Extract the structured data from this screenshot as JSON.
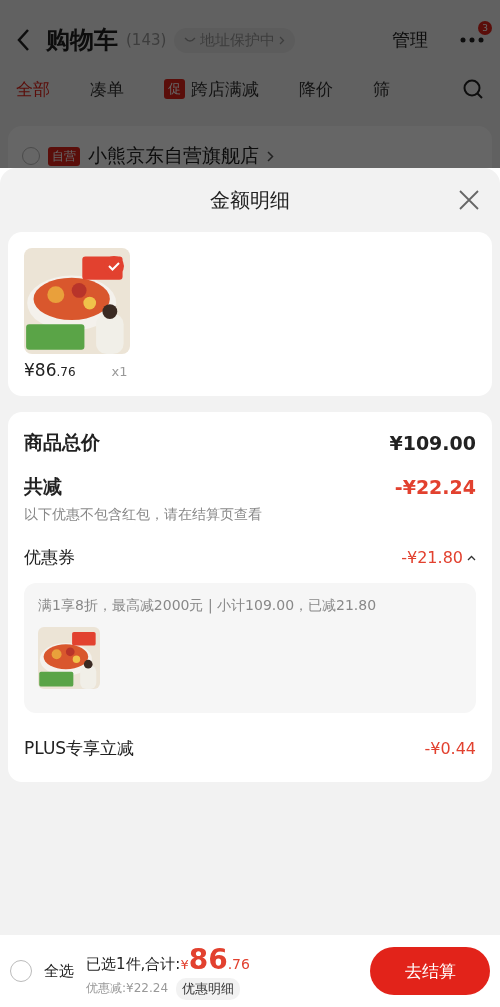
{
  "header": {
    "title": "购物车",
    "count": "(143)",
    "address_chip": "地址保护中",
    "manage": "管理",
    "more_badge": "3"
  },
  "tabs": [
    {
      "label": "全部",
      "selected": true
    },
    {
      "label": "凑单",
      "selected": false
    },
    {
      "label": "跨店满减",
      "tag": "促",
      "selected": false
    },
    {
      "label": "降价",
      "selected": false
    },
    {
      "label": "筛",
      "selected": false
    }
  ],
  "store": {
    "tag": "自营",
    "name": "小熊京东自营旗舰店",
    "checked": false
  },
  "sheet": {
    "title": "金额明细",
    "product": {
      "kind": "picture",
      "price_int": "¥86",
      "price_dec": ".76",
      "quantity": "x1",
      "checked": true
    },
    "total_label": "商品总价",
    "total_value": "¥109.00",
    "reduce_label": "共减",
    "reduce_value": "-¥22.24",
    "reduce_note": "以下优惠不包含红包，请在结算页查看",
    "coupon_label": "优惠券",
    "coupon_value": "-¥21.80",
    "coupon_expanded": true,
    "coupon_detail": "满1享8折，最高减2000元 | 小计109.00，已减21.80",
    "plus_label": "PLUS专享立减",
    "plus_value": "-¥0.44"
  },
  "footer": {
    "select_all": "全选",
    "select_all_checked": false,
    "summary": "已选1件,合计:",
    "currency": "¥",
    "total_int": "86",
    "total_dec": ".76",
    "discount": "优惠减:¥22.24",
    "detail_button": "优惠明细",
    "checkout": "去结算"
  }
}
